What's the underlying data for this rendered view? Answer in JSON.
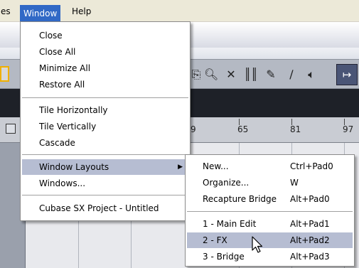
{
  "menubar": {
    "items": [
      {
        "label": "es"
      },
      {
        "label": "Window"
      },
      {
        "label": "Help"
      }
    ]
  },
  "ruler": {
    "labels": [
      "9",
      "65",
      "81",
      "97"
    ]
  },
  "window_menu": {
    "items": [
      {
        "label": "Close"
      },
      {
        "label": "Close All"
      },
      {
        "label": "Minimize All"
      },
      {
        "label": "Restore All"
      },
      {
        "label": "Tile Horizontally"
      },
      {
        "label": "Tile Vertically"
      },
      {
        "label": "Cascade"
      },
      {
        "label": "Window Layouts"
      },
      {
        "label": "Windows..."
      },
      {
        "label": "Cubase SX Project - Untitled"
      }
    ]
  },
  "layouts_submenu": {
    "items": [
      {
        "label": "New...",
        "shortcut": "Ctrl+Pad0"
      },
      {
        "label": "Organize...",
        "shortcut": "W"
      },
      {
        "label": "Recapture Bridge",
        "shortcut": "Alt+Pad0"
      },
      {
        "label": "1 - Main Edit",
        "shortcut": "Alt+Pad1"
      },
      {
        "label": "2 - FX",
        "shortcut": "Alt+Pad2"
      },
      {
        "label": "3 - Bridge",
        "shortcut": "Alt+Pad3"
      }
    ]
  },
  "colors": {
    "menubar_selected": "#3169c6",
    "menu_highlight": "#b6bdd2",
    "toolbar": "#b4b9c3",
    "dark_strip": "#1e2128"
  }
}
